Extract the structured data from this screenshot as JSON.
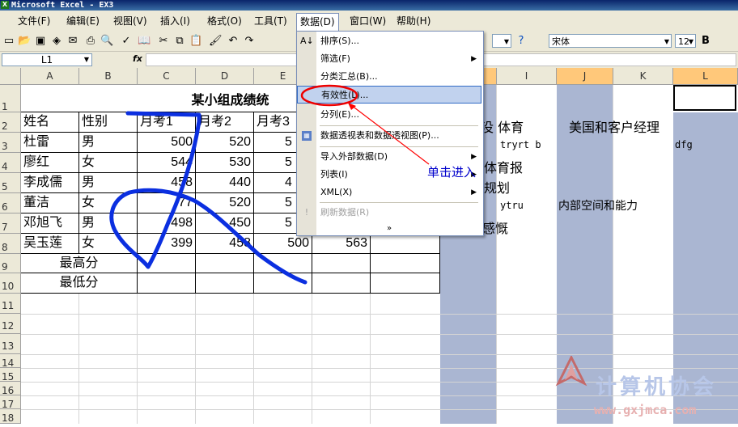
{
  "window": {
    "title": "Microsoft Excel - EX3"
  },
  "menu": [
    {
      "label": "文件(F)"
    },
    {
      "label": "编辑(E)"
    },
    {
      "label": "视图(V)"
    },
    {
      "label": "插入(I)"
    },
    {
      "label": "格式(O)"
    },
    {
      "label": "工具(T)"
    },
    {
      "label": "数据(D)"
    },
    {
      "label": "窗口(W)"
    },
    {
      "label": "帮助(H)"
    }
  ],
  "toolbar": {
    "font": "宋体",
    "size": "12",
    "bold": "B"
  },
  "formula": {
    "name_box": "L1",
    "fx": "fx",
    "value": ""
  },
  "columns": [
    "A",
    "B",
    "C",
    "D",
    "E",
    "F",
    "G",
    "H",
    "I",
    "J",
    "K",
    "L"
  ],
  "rows": [
    "1",
    "2",
    "3",
    "4",
    "5",
    "6",
    "7",
    "8",
    "9",
    "10",
    "11",
    "12",
    "13",
    "14",
    "15",
    "16",
    "17",
    "18"
  ],
  "sheet": {
    "title": "某小组成绩统",
    "headers": [
      "姓名",
      "性别",
      "月考1",
      "月考2",
      "月考3"
    ],
    "data": [
      [
        "杜雷",
        "男",
        "500",
        "520",
        "5"
      ],
      [
        "廖红",
        "女",
        "544",
        "530",
        "5"
      ],
      [
        "李成儒",
        "男",
        "458",
        "440",
        "4"
      ],
      [
        "董洁",
        "女",
        "77",
        "520",
        "5"
      ],
      [
        "邓旭飞",
        "男",
        "498",
        "450",
        "5"
      ],
      [
        "吴玉莲",
        "女",
        "399",
        "458",
        "500",
        "563"
      ]
    ],
    "max_label": "最高分",
    "min_label": "最低分",
    "right_cells": {
      "h2": "没 体育",
      "j2": "美国和客户经理",
      "i3": "tryrt b",
      "l3": "dfg",
      "h4": "体育报",
      "h5": "规划",
      "i6": "ytru",
      "j6": "内部空间和能力",
      "h7": "感慨"
    }
  },
  "data_menu": [
    {
      "label": "排序(S)...",
      "icon": "sort-icon"
    },
    {
      "label": "筛选(F)",
      "submenu": true
    },
    {
      "label": "分类汇总(B)..."
    },
    {
      "label": "有效性(L)...",
      "highlight": true
    },
    {
      "label": "分列(E)..."
    },
    {
      "label": "数据透视表和数据透视图(P)...",
      "icon": "pivot-icon"
    },
    {
      "label": "导入外部数据(D)",
      "submenu": true
    },
    {
      "label": "列表(I)",
      "submenu": true
    },
    {
      "label": "XML(X)",
      "submenu": true
    },
    {
      "label": "刷新数据(R)",
      "disabled": true
    }
  ],
  "annotation": {
    "text": "单击进入",
    "color": "#0000cc",
    "arrow_color": "#ff0000",
    "circle_color": "#ee0000"
  },
  "watermark": {
    "text": "计算机协会",
    "url": "www.gxjmca.com"
  }
}
